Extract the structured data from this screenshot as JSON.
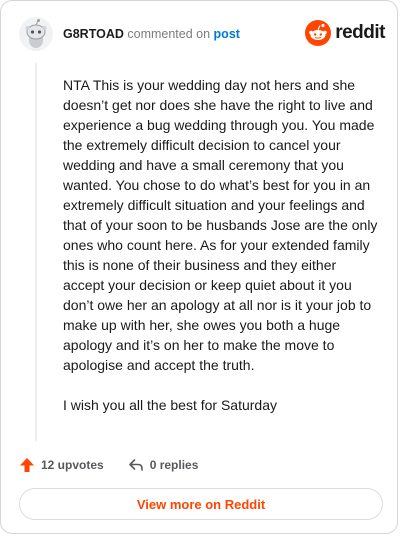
{
  "comment": {
    "username": "G8RTOAD",
    "action_text": "commented on",
    "post_link": "post",
    "paragraphs": [
      "NTA This is your wedding day not hers and she doesn’t get nor does she have the right to live and experience a bug wedding through you. You made the extremely difficult decision to cancel your wedding and have a small ceremony that you wanted. You chose to do what’s best for you in an extremely difficult situation and your feelings and that of your soon to be husbands Jose are the only ones who count here. As for your extended family this is none of their business and they either accept your decision or keep quiet about it you don’t owe her an apology at all nor is it your job to make up with her, she owes you both a huge apology and it’s on her to make the move to apologise and accept the truth.",
      "I wish you all the best for Saturday"
    ]
  },
  "brand": {
    "name": "reddit",
    "icon": "reddit-logo-icon",
    "color": "#ff4500"
  },
  "actions": {
    "upvotes": "12 upvotes",
    "upvote_icon": "arrow-up-icon",
    "replies": "0 replies",
    "reply_icon": "reply-arrow-icon"
  },
  "footer": {
    "view_more": "View more on Reddit"
  },
  "colors": {
    "accent": "#ff4500",
    "link": "#0079d3",
    "muted": "#7c7c7c"
  }
}
